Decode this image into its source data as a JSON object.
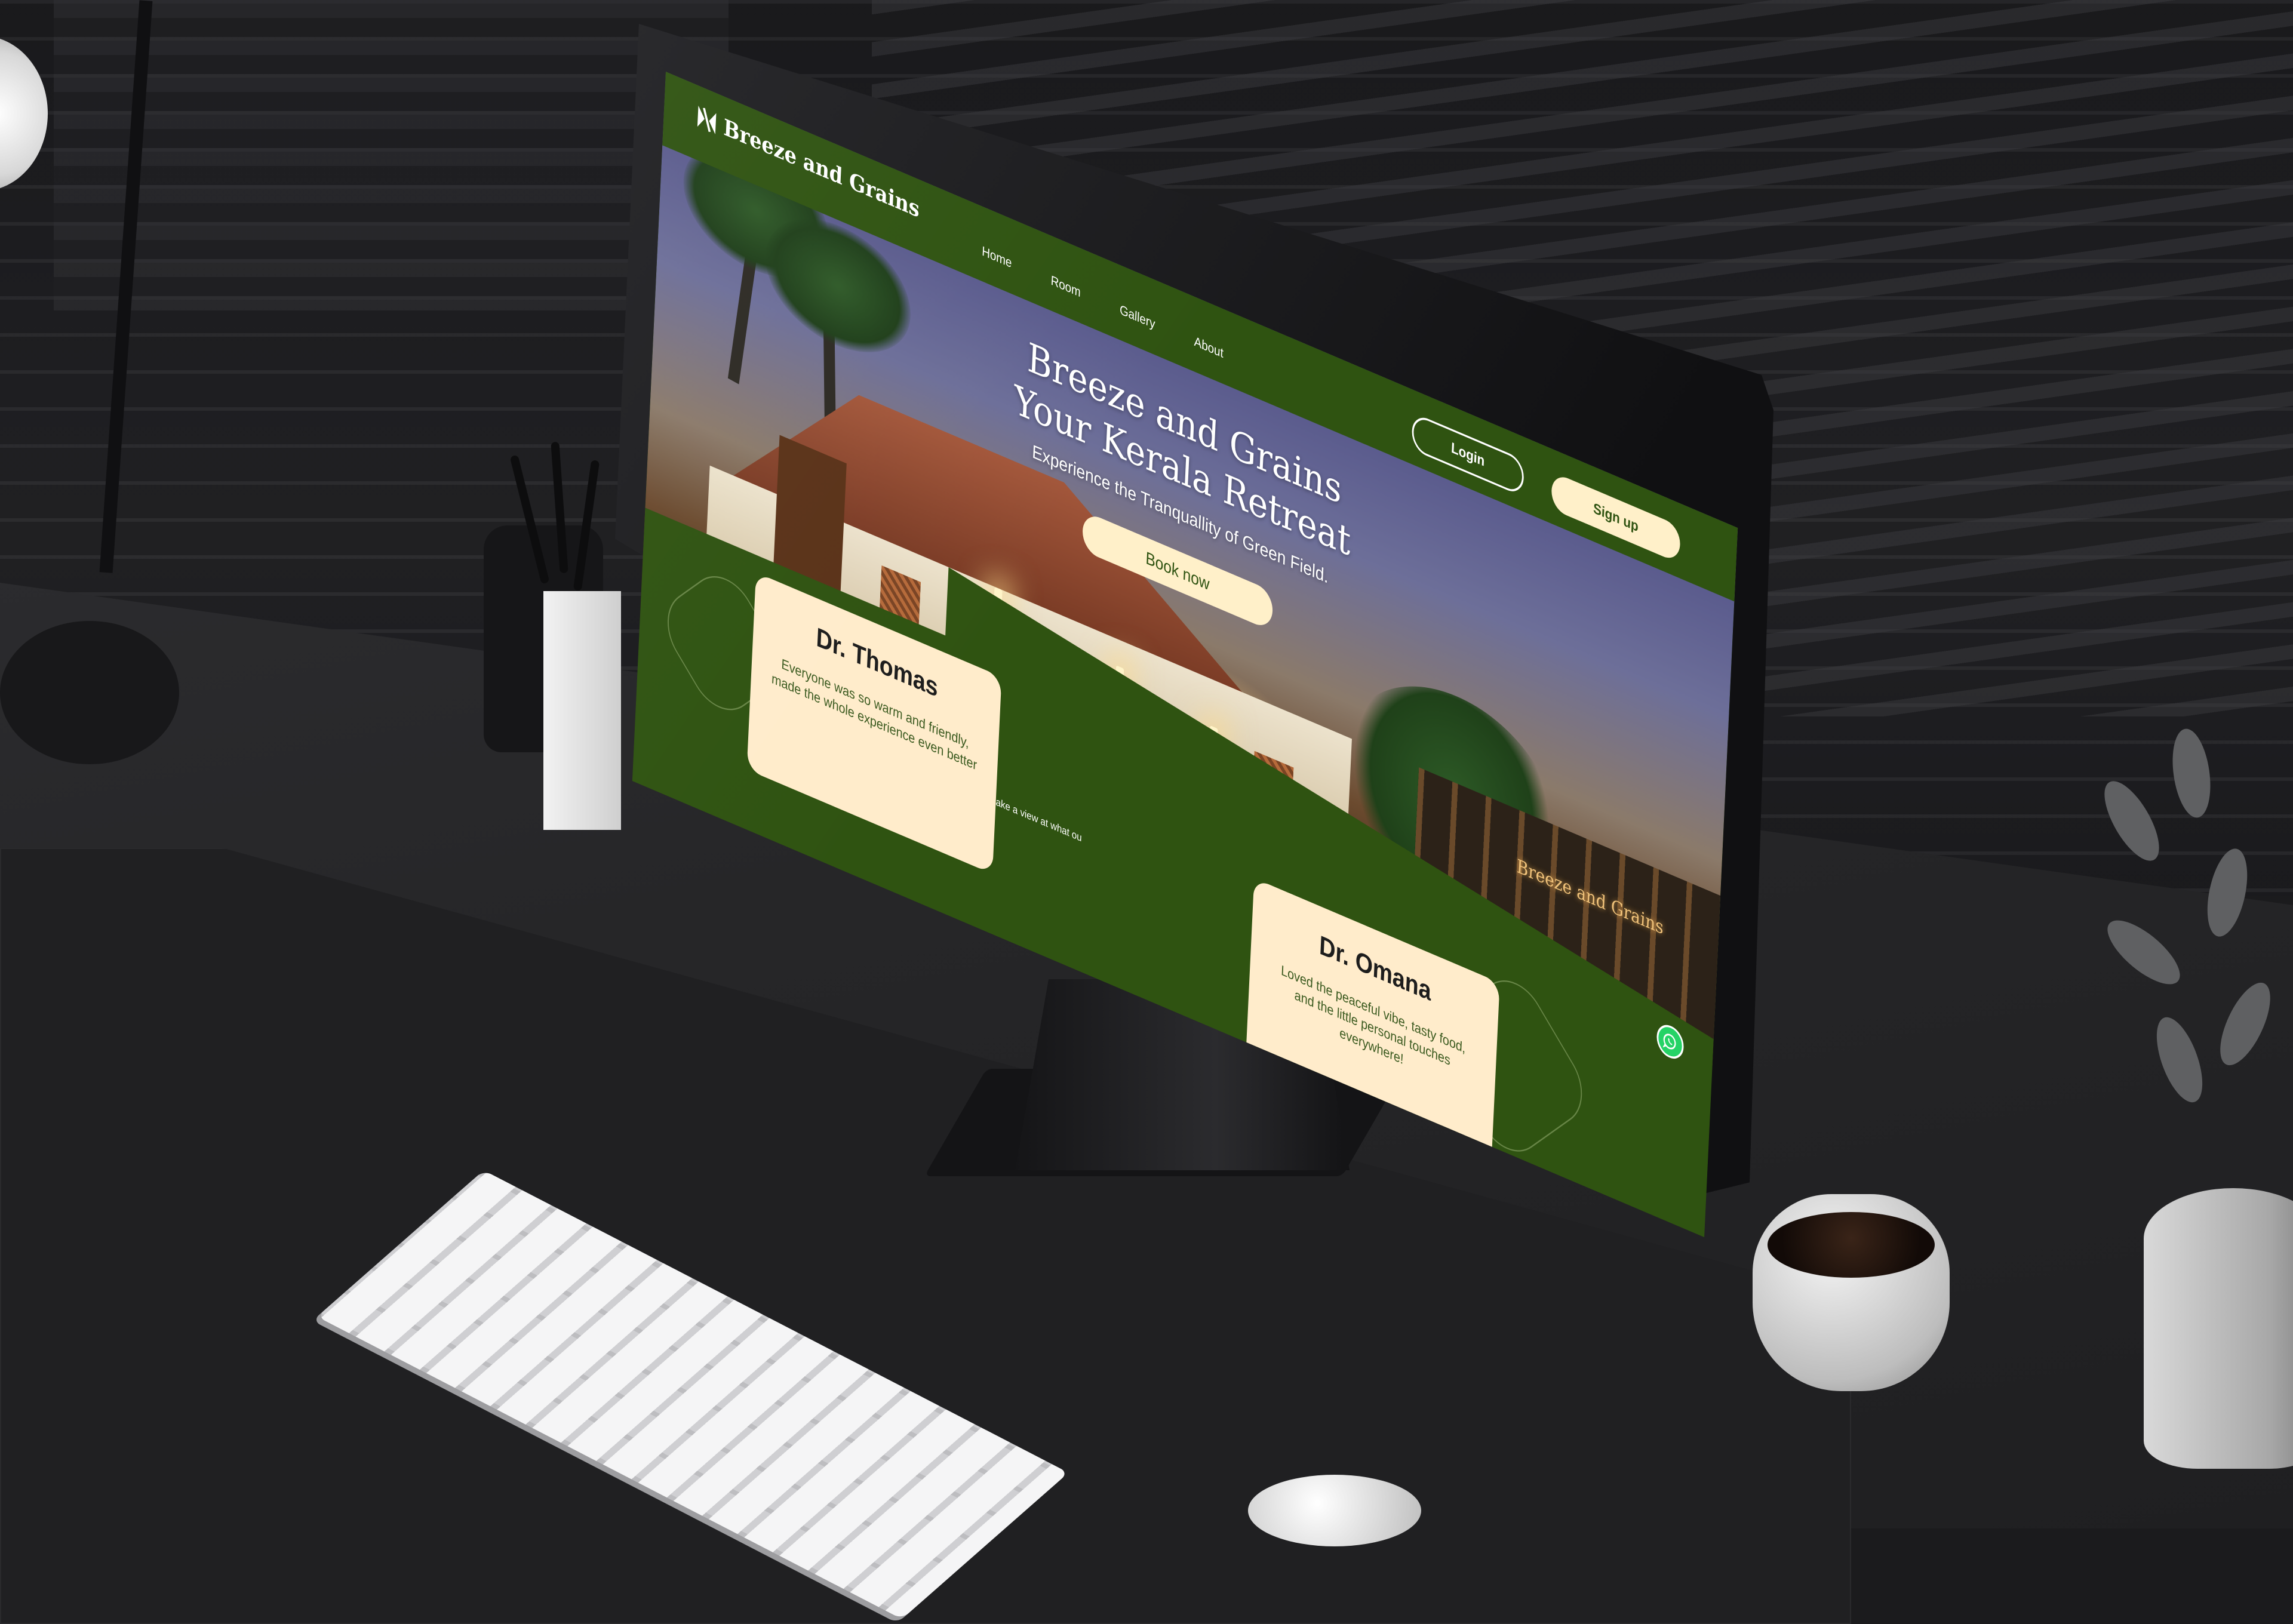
{
  "site": {
    "brand": "Breeze and Grains",
    "nav": [
      {
        "label": "Home"
      },
      {
        "label": "Room"
      },
      {
        "label": "Gallery"
      },
      {
        "label": "About"
      }
    ],
    "login_label": "Login",
    "signup_label": "Sign up"
  },
  "hero": {
    "title_line1": "Breeze and Grains",
    "title_line2": "Your Kerala Retreat",
    "subtitle": "Experience the Tranquallity of Green Field.",
    "cta_label": "Book now",
    "signboard": "Breeze and Grains"
  },
  "intro_text": "ng ahead, take a view at what ou",
  "testimonials": [
    {
      "name": "Dr. Thomas",
      "quote": "Everyone was so warm and friendly, made the whole experience even better"
    },
    {
      "name": "Dr. Omana",
      "quote": "Loved the peaceful vibe, tasty food, and the little personal touches everywhere!"
    }
  ],
  "icons": {
    "logo": "breeze-logo-icon",
    "whatsapp": "whatsapp-icon",
    "device_brand": "apple-logo-icon"
  },
  "colors": {
    "brand_green": "#2f5311",
    "cream": "#fff0c9",
    "card": "#ffeccb",
    "whatsapp": "#25d366"
  }
}
